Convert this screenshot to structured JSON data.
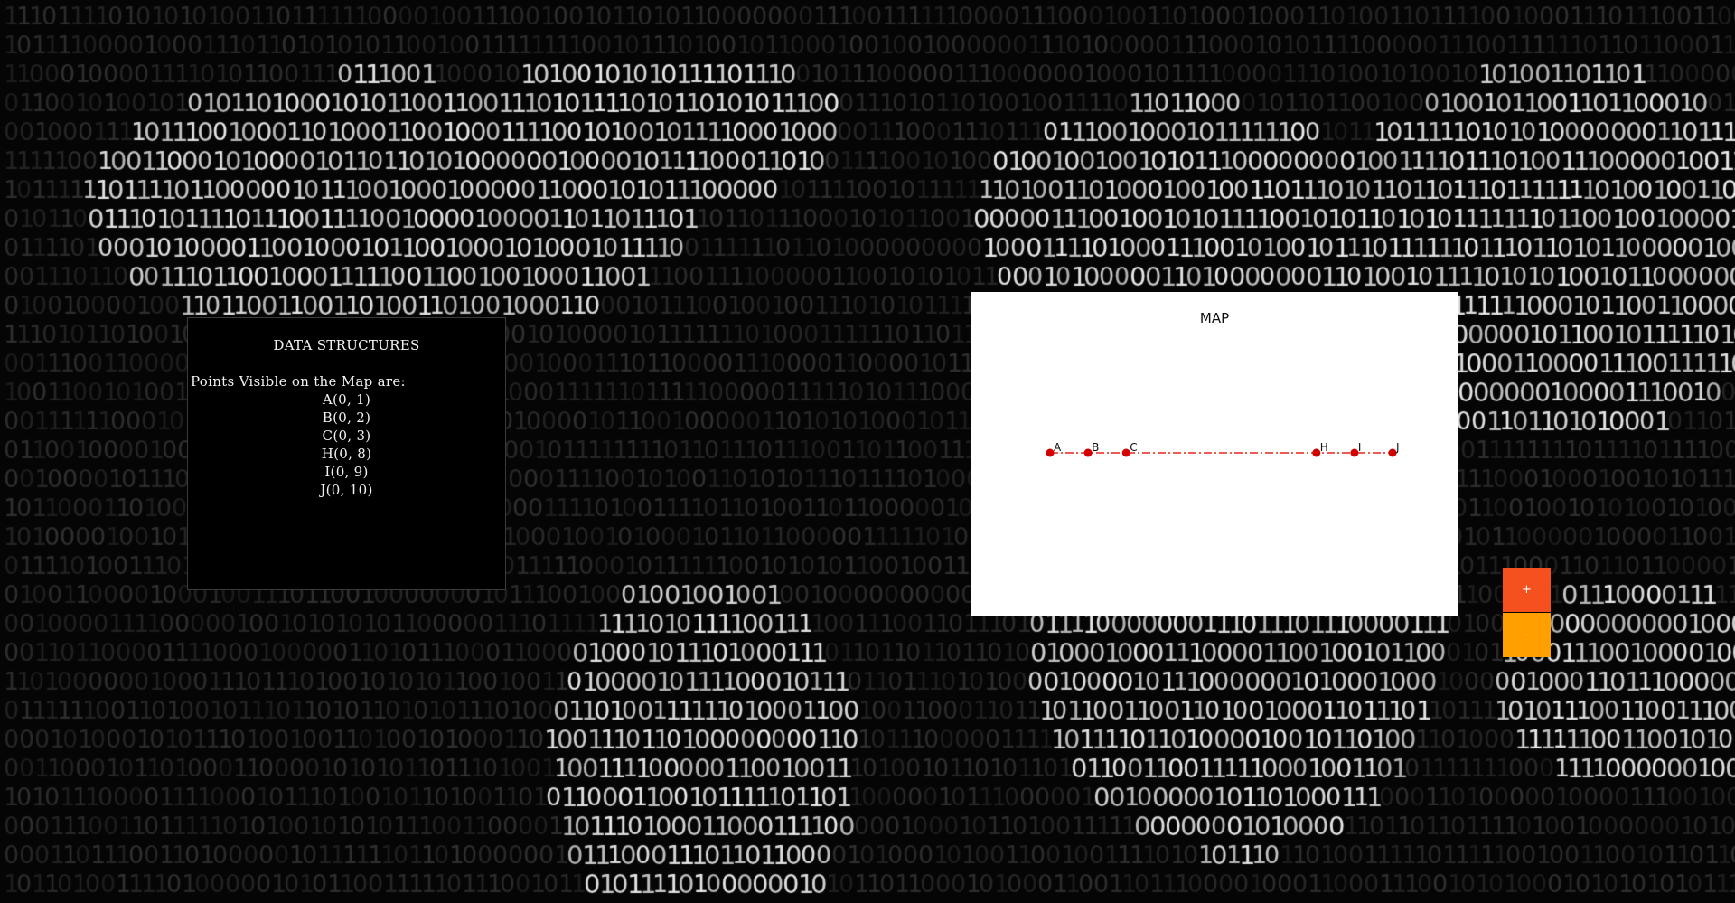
{
  "data_structures": {
    "title": "DATA STRUCTURES",
    "intro": "Points Visible on the Map are:",
    "points": [
      "A(0, 1)",
      "B(0, 2)",
      "C(0, 3)",
      "H(0, 8)",
      "I(0, 9)",
      "J(0, 10)"
    ]
  },
  "map": {
    "title": "MAP",
    "line_color": "#e8231b",
    "point_color": "#d40000",
    "points": [
      {
        "label": "A",
        "x": 0,
        "y": 1
      },
      {
        "label": "B",
        "x": 0,
        "y": 2
      },
      {
        "label": "C",
        "x": 0,
        "y": 3
      },
      {
        "label": "H",
        "x": 0,
        "y": 8
      },
      {
        "label": "I",
        "x": 0,
        "y": 9
      },
      {
        "label": "J",
        "x": 0,
        "y": 10
      }
    ]
  },
  "controls": {
    "zoom_in_label": "+",
    "zoom_out_label": "-",
    "zoom_in_color": "#f4511e",
    "zoom_out_color": "#ff9f00"
  },
  "background": {
    "style": "binary-world-map"
  }
}
